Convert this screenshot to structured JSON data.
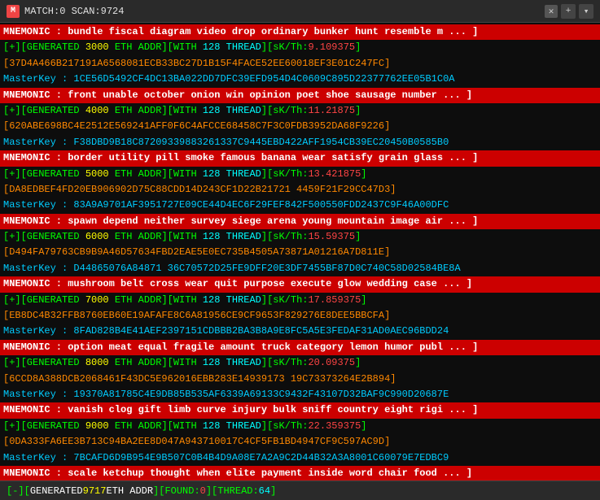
{
  "titlebar": {
    "icon": "M",
    "title": "MATCH:0 SCAN:9724",
    "close_label": "✕",
    "plus_label": "+",
    "chevron_label": "▾"
  },
  "rows": [
    {
      "type": "mnemonic",
      "text": "MNEMONIC : bundle fiscal diagram video drop ordinary bunker hunt resemble m ... ]"
    },
    {
      "type": "generated",
      "parts": [
        {
          "color": "green",
          "text": "[+][GENERATED "
        },
        {
          "color": "yellow",
          "text": "3000"
        },
        {
          "color": "green",
          "text": " ETH ADDR][WITH "
        },
        {
          "color": "cyan",
          "text": "128 THREAD"
        },
        {
          "color": "green",
          "text": "][sK/Th:"
        },
        {
          "color": "red",
          "text": "9.109375"
        },
        {
          "color": "green",
          "text": "]"
        }
      ]
    },
    {
      "type": "addr",
      "text": "[37D4A466B217191A6568081ECB33BC27D1B15F4FACE52EE60018EF3E01C247FC]"
    },
    {
      "type": "masterkey",
      "text": "MasterKey :  1CE56D5492CF4DC13BA022DD7DFC39EFD954D4C0609C895D22377762EE05B1C0A"
    },
    {
      "type": "mnemonic",
      "text": "MNEMONIC : front unable october onion win opinion poet shoe sausage number ... ]"
    },
    {
      "type": "generated",
      "parts": [
        {
          "color": "green",
          "text": "[+][GENERATED "
        },
        {
          "color": "yellow",
          "text": "4000"
        },
        {
          "color": "green",
          "text": " ETH ADDR][WITH "
        },
        {
          "color": "cyan",
          "text": "128 THREAD"
        },
        {
          "color": "green",
          "text": "][sK/Th:"
        },
        {
          "color": "red",
          "text": "11.21875"
        },
        {
          "color": "green",
          "text": "]"
        }
      ]
    },
    {
      "type": "addr",
      "text": "[620ABE698BC4E2512E569241AFF0F6C4AFCCE68458C7F3C0FDB3952DA68F9226]"
    },
    {
      "type": "masterkey",
      "text": "MasterKey :  F38DBD9B18C87209339883261337C9445EBD422AFF1954CB39EC20450B0585B0"
    },
    {
      "type": "mnemonic",
      "text": "MNEMONIC : border utility pill smoke famous banana wear satisfy grain glass ... ]"
    },
    {
      "type": "generated",
      "parts": [
        {
          "color": "green",
          "text": "[+][GENERATED "
        },
        {
          "color": "yellow",
          "text": "5000"
        },
        {
          "color": "green",
          "text": " ETH ADDR][WITH "
        },
        {
          "color": "cyan",
          "text": "128 THREAD"
        },
        {
          "color": "green",
          "text": "][sK/Th:"
        },
        {
          "color": "red",
          "text": "13.421875"
        },
        {
          "color": "green",
          "text": "]"
        }
      ]
    },
    {
      "type": "addr",
      "text": "[DA8EDBEF4FD20EB906902D75C88CDD14D243CF1D22B21721 4459F21F29CC47D3]"
    },
    {
      "type": "masterkey",
      "text": "MasterKey :  83A9A9701AF3951727E09CE44D4EC6F29FEF842F500550FDD2437C9F46A00DFC"
    },
    {
      "type": "mnemonic",
      "text": "MNEMONIC : spawn depend neither survey siege arena young mountain image air ... ]"
    },
    {
      "type": "generated",
      "parts": [
        {
          "color": "green",
          "text": "[+][GENERATED "
        },
        {
          "color": "yellow",
          "text": "6000"
        },
        {
          "color": "green",
          "text": " ETH ADDR][WITH "
        },
        {
          "color": "cyan",
          "text": "128 THREAD"
        },
        {
          "color": "green",
          "text": "][sK/Th:"
        },
        {
          "color": "red",
          "text": "15.59375"
        },
        {
          "color": "green",
          "text": "]"
        }
      ]
    },
    {
      "type": "addr",
      "text": "[D494FA79763CB9B9A46D57634FBD2EAE5E0EC735B4505A73871A01216A7D811E]"
    },
    {
      "type": "masterkey",
      "text": "MasterKey :  D44865076A84871 36C70572D25FE9DFF20E3DF7455BF87D0C740C58D02584BE8A"
    },
    {
      "type": "mnemonic",
      "text": "MNEMONIC : mushroom belt cross wear quit purpose execute glow wedding case ... ]"
    },
    {
      "type": "generated",
      "parts": [
        {
          "color": "green",
          "text": "[+][GENERATED "
        },
        {
          "color": "yellow",
          "text": "7000"
        },
        {
          "color": "green",
          "text": " ETH ADDR][WITH "
        },
        {
          "color": "cyan",
          "text": "128 THREAD"
        },
        {
          "color": "green",
          "text": "][sK/Th:"
        },
        {
          "color": "red",
          "text": "17.859375"
        },
        {
          "color": "green",
          "text": "]"
        }
      ]
    },
    {
      "type": "addr",
      "text": "[EB8DC4B32FFB8760EB60E19AFAFE8C6A81956CE9CF9653F829276E8DEE5BBCFA]"
    },
    {
      "type": "masterkey",
      "text": "MasterKey :  8FAD828B4E41AEF2397151CDBBB2BA3B8A9E8FC5A5E3FEDAF31AD0AEC96BDD24"
    },
    {
      "type": "mnemonic",
      "text": "MNEMONIC : option meat equal fragile amount truck category lemon humor publ ... ]"
    },
    {
      "type": "generated",
      "parts": [
        {
          "color": "green",
          "text": "[+][GENERATED "
        },
        {
          "color": "yellow",
          "text": "8000"
        },
        {
          "color": "green",
          "text": " ETH ADDR][WITH "
        },
        {
          "color": "cyan",
          "text": "128 THREAD"
        },
        {
          "color": "green",
          "text": "][sK/Th:"
        },
        {
          "color": "red",
          "text": "20.09375"
        },
        {
          "color": "green",
          "text": "]"
        }
      ]
    },
    {
      "type": "addr",
      "text": "[6CCD8A388DCB2068461F43DC5E962016EBB283E14939173 19C73373264E2B894]"
    },
    {
      "type": "masterkey",
      "text": "MasterKey :  19370A81785C4E9DB85B535AF6339A69133C9432F43107D32BAF9C990D20687E"
    },
    {
      "type": "mnemonic",
      "text": "MNEMONIC : vanish clog gift limb curve injury bulk sniff country eight rigi ... ]"
    },
    {
      "type": "generated",
      "parts": [
        {
          "color": "green",
          "text": "[+][GENERATED "
        },
        {
          "color": "yellow",
          "text": "9000"
        },
        {
          "color": "green",
          "text": " ETH ADDR][WITH "
        },
        {
          "color": "cyan",
          "text": "128 THREAD"
        },
        {
          "color": "green",
          "text": "][sK/Th:"
        },
        {
          "color": "red",
          "text": "22.359375"
        },
        {
          "color": "green",
          "text": "]"
        }
      ]
    },
    {
      "type": "addr",
      "text": "[0DA333FA6EE3B713C94BA2EE8D047A943710017C4CF5FB1BD4947CF9C597AC9D]"
    },
    {
      "type": "masterkey",
      "text": "MasterKey :  7BCAFD6D9B954E9B507C0B4B4D9A08E7A2A9C2D44B32A3A8001C60079E7EDBC9"
    },
    {
      "type": "mnemonic",
      "text": "MNEMONIC : scale ketchup thought when elite payment inside word chair food ... ]"
    }
  ],
  "statusbar": {
    "prefix": "[-][",
    "generated_label": " GENERATED ",
    "generated_value": "9717",
    "eth_label": " ETH ADDR ",
    "found_label": "][FOUND:",
    "found_value": "0",
    "thread_label": "][THREAD:",
    "thread_value": "64",
    "suffix": "]"
  }
}
